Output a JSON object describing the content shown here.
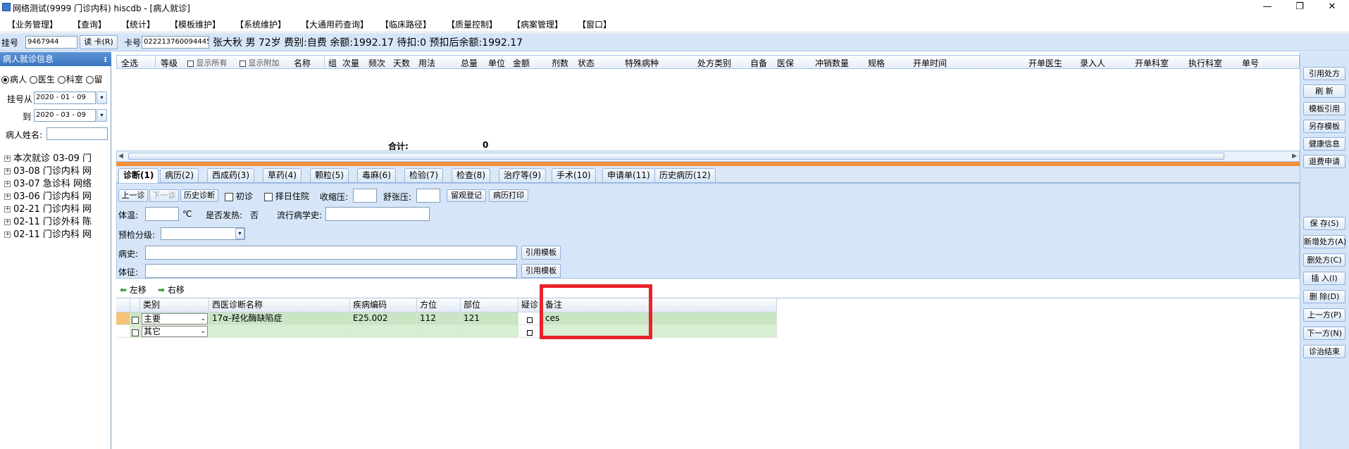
{
  "window": {
    "title": "网络测试(9999 门诊内科)  hiscdb - [病人就诊]",
    "minimize": "—",
    "restore": "❐",
    "close": "✕"
  },
  "menu": [
    "【业务管理】",
    "【查询】",
    "【统计】",
    "【模板维护】",
    "【系统维护】",
    "【大通用药查询】",
    "【临床路径】",
    "【质量控制】",
    "【病案管理】",
    "【窗口】"
  ],
  "patient_bar": {
    "reg_label": "挂号",
    "reg_no": "9467944",
    "read_card_btn": "读 卡(R)",
    "card_label": "卡号",
    "card_no": "022213760094445",
    "info": "张大秋  男  72岁  费别:自费  余额:1992.17  待扣:0  预扣后余额:1992.17"
  },
  "left_panel": {
    "header": "病人就诊信息",
    "pin": "ᵻ",
    "radio_patient": "病人",
    "radio_doctor": "医生",
    "radio_dept": "科室",
    "radio_other": "留",
    "reg_from_label": "挂号从",
    "date_from": "2020 - 01 - 09",
    "to_label": "到",
    "date_to": "2020 - 03 - 09",
    "patient_name_label": "病人姓名:",
    "tree": [
      "本次就诊 03-09 门",
      "03-08 门诊内科 网",
      "03-07 急诊科 网络",
      "03-06 门诊内科 网",
      "02-21 门诊内科 网",
      "02-11 门诊外科 陈",
      "02-11 门诊内科 网"
    ]
  },
  "rx_table": {
    "select_all": "全选",
    "columns": [
      "等级",
      "显示所有",
      "显示附加",
      "名称",
      "组",
      "次量",
      "频次",
      "天数",
      "用法",
      "总量",
      "单位",
      "金额",
      "剂数",
      "状态",
      "特殊病种",
      "处方类别",
      "自备",
      "医保",
      "冲销数量",
      "规格",
      "开单时间",
      "开单医生",
      "录入人",
      "开单科室",
      "执行科室",
      "单号"
    ],
    "total_label": "合计:",
    "total_value": "0"
  },
  "tabs": [
    "诊断(1)",
    "病历(2)",
    "西成药(3)",
    "草药(4)",
    "颗粒(5)",
    "毒麻(6)",
    "检验(7)",
    "检查(8)",
    "治疗等(9)",
    "手术(10)",
    "申请单(11)",
    "历史病历(12)"
  ],
  "diag_form": {
    "prev_btn": "上一诊",
    "next_btn": "下一诊",
    "history_btn": "历史诊断",
    "first_visit": "初诊",
    "select_hospital": "择日住院",
    "systolic_label": "收缩压:",
    "diastolic_label": "舒张压:",
    "observe_btn": "留观登记",
    "print_btn": "病历打印",
    "temp_label": "体温:",
    "temp_unit": "℃",
    "fever_label": "是否发热:",
    "fever_value": "否",
    "epi_label": "流行病学史:",
    "triage_label": "预检分级:",
    "history_label": "病史:",
    "sign_label": "体征:",
    "template_btn": "引用模板"
  },
  "move": {
    "left": "左移",
    "right": "右移"
  },
  "diag_grid": {
    "headers": [
      "类别",
      "西医诊断名称",
      "疾病编码",
      "方位",
      "部位",
      "疑诊",
      "备注"
    ],
    "rows": [
      {
        "type": "主要",
        "name": "17α-羟化酶缺陷症",
        "code": "E25.002",
        "direction": "112",
        "site": "121",
        "remark": "ces"
      },
      {
        "type": "其它",
        "name": "",
        "code": "",
        "direction": "",
        "site": "",
        "remark": ""
      }
    ]
  },
  "right_buttons": {
    "top": [
      "引用处方",
      "刷 新",
      "模板引用",
      "另存模板",
      "健康信息",
      "退费申请"
    ],
    "bottom": [
      "保 存(S)",
      "新增处方(A)",
      "删处方(C)",
      "插 入(I)",
      "删 除(D)",
      "上一方(P)",
      "下一方(N)",
      "诊治结束"
    ]
  },
  "colors": {
    "panel": "#d6e6f8",
    "accent": "#f0903b",
    "highlight": "#e8232a",
    "row": "#c9e5c3"
  }
}
